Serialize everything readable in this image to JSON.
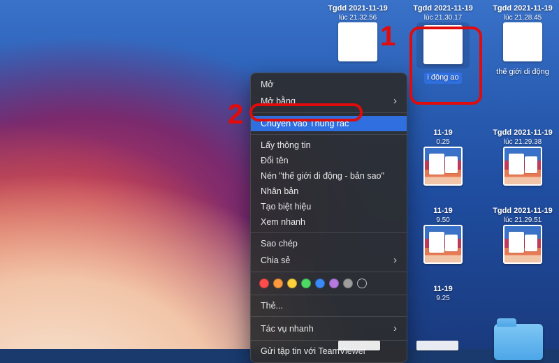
{
  "desktop_icons": [
    {
      "slot": "r1c1",
      "title": "Tgdd 2021-11-19",
      "sub": "lúc 21.32.56",
      "kind": "doc"
    },
    {
      "slot": "r1c2",
      "title": "Tgdd 2021-11-19",
      "sub": "lúc 21.30.17",
      "kind": "doc",
      "selected": true,
      "caption": "i động\nao"
    },
    {
      "slot": "r1c3",
      "title": "Tgdd 2021-11-19",
      "sub": "lúc 21.28.45",
      "kind": "doc",
      "caption": "thế giới di động"
    },
    {
      "slot": "r2c2",
      "title": "11-19",
      "sub": "0.25",
      "kind": "ss"
    },
    {
      "slot": "r2c3",
      "title": "Tgdd 2021-11-19",
      "sub": "lúc 21.29.38",
      "kind": "ss"
    },
    {
      "slot": "r3c2",
      "title": "11-19",
      "sub": "9.50",
      "kind": "ss"
    },
    {
      "slot": "r3c3",
      "title": "Tgdd 2021-11-19",
      "sub": "lúc 21.29.51",
      "kind": "ss"
    },
    {
      "slot": "r4c2",
      "title": "11-19",
      "sub": "9.25",
      "kind": "ss-partial"
    }
  ],
  "context_menu": {
    "groups": [
      [
        {
          "label": "Mở"
        },
        {
          "label": "Mở bằng",
          "submenu": true
        }
      ],
      [
        {
          "label": "Chuyển vào Thùng rác",
          "highlight": true
        }
      ],
      [
        {
          "label": "Lấy thông tin"
        },
        {
          "label": "Đổi tên"
        },
        {
          "label": "Nén \"thế giới di động - bản sao\""
        },
        {
          "label": "Nhân bản"
        },
        {
          "label": "Tạo biệt hiệu"
        },
        {
          "label": "Xem nhanh"
        }
      ],
      [
        {
          "label": "Sao chép"
        },
        {
          "label": "Chia sẻ",
          "submenu": true
        }
      ],
      "tags",
      [
        {
          "label": "Thẻ...",
          "submenu": false
        }
      ],
      [
        {
          "label": "Tác vụ nhanh",
          "submenu": true
        }
      ],
      [
        {
          "label": "Gửi tập tin với TeamViewer"
        }
      ]
    ],
    "tag_colors": [
      "#ff4d4d",
      "#ff9a3c",
      "#ffd23c",
      "#4cd964",
      "#3a8af7",
      "#b57ae0",
      "#9d9d9d"
    ]
  },
  "annotations": {
    "step1": "1",
    "step2": "2"
  }
}
